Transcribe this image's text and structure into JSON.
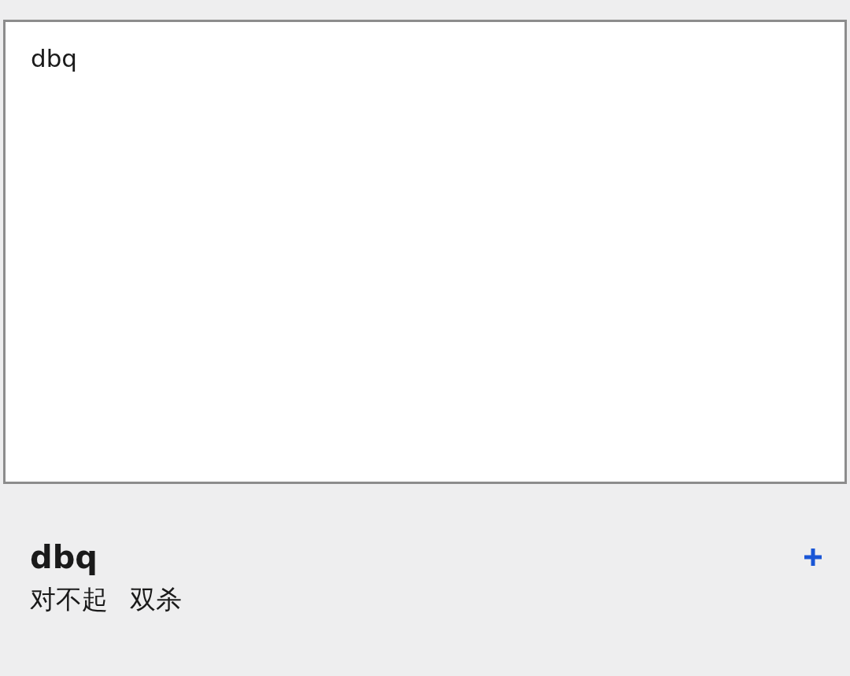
{
  "input": {
    "value": "dbq"
  },
  "result": {
    "term": "dbq",
    "meanings": [
      "对不起",
      "双杀"
    ]
  }
}
